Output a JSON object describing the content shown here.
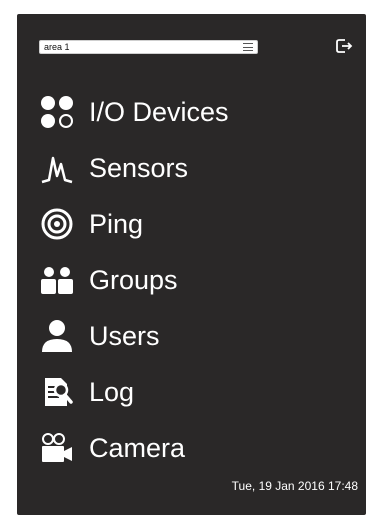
{
  "area_selector": {
    "value": "area 1"
  },
  "nav": {
    "items": [
      {
        "label": "I/O Devices",
        "icon": "io-devices-icon"
      },
      {
        "label": "Sensors",
        "icon": "sensor-icon"
      },
      {
        "label": "Ping",
        "icon": "ping-icon"
      },
      {
        "label": "Groups",
        "icon": "groups-icon"
      },
      {
        "label": "Users",
        "icon": "user-icon"
      },
      {
        "label": "Log",
        "icon": "log-icon"
      },
      {
        "label": "Camera",
        "icon": "camera-icon"
      }
    ]
  },
  "footer": {
    "datetime": "Tue, 19 Jan 2016 17:48"
  },
  "colors": {
    "panel_background": "#2a2828",
    "text": "#ffffff",
    "selector_background": "#ffffff"
  }
}
